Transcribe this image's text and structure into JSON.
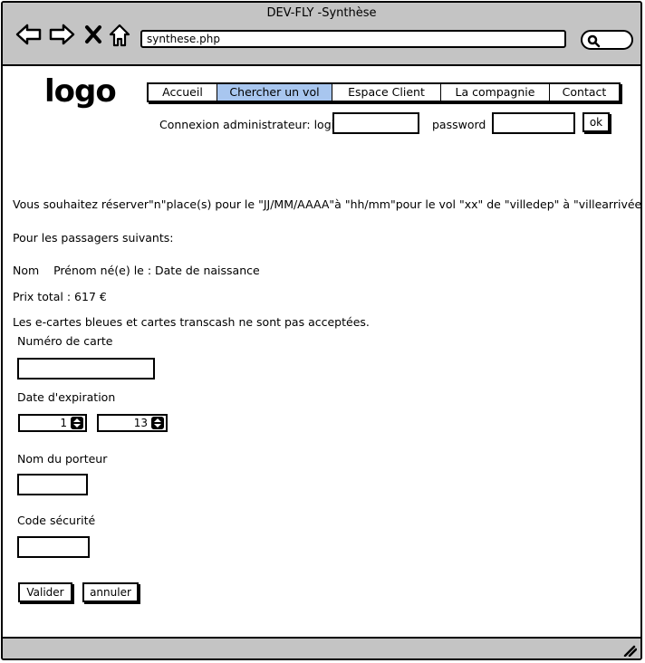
{
  "window": {
    "title": "DEV-FLY -Synthèse"
  },
  "browser": {
    "url": "synthese.php"
  },
  "header": {
    "logo": "logo",
    "menu": [
      {
        "label": "Accueil",
        "active": false
      },
      {
        "label": "Chercher un vol",
        "active": true
      },
      {
        "label": "Espace Client",
        "active": false
      },
      {
        "label": "La compagnie",
        "active": false
      },
      {
        "label": "Contact",
        "active": false
      }
    ],
    "admin": {
      "login_label": "Connexion administrateur: login",
      "login_value": "",
      "password_label": "password",
      "password_value": "",
      "ok_label": "ok"
    }
  },
  "content": {
    "reservation_sentence": "Vous souhaitez réserver\"n\"place(s) pour le \"JJ/MM/AAAA\"à \"hh/mm\"pour le vol \"xx\" de \"villedep\" à \"villearrivée\".",
    "passengers_intro": "Pour les passagers suivants:",
    "passenger_columns": "Nom    Prénom né(e) le : Date de naissance",
    "total_price": "Prix total : 617 €",
    "card_notice": "Les e-cartes bleues et cartes transcash ne sont pas acceptées."
  },
  "form": {
    "card_number_label": "Numéro de carte",
    "card_number_value": "",
    "expiry_label": "Date d'expiration",
    "expiry_month": "1",
    "expiry_year": "13",
    "holder_label": "Nom du porteur",
    "holder_value": "",
    "security_label": "Code sécurité",
    "security_value": "",
    "submit_label": "Valider",
    "cancel_label": "annuler"
  },
  "colors": {
    "chrome": "#c4c4c4",
    "active_menu": "#a8c6ef"
  }
}
